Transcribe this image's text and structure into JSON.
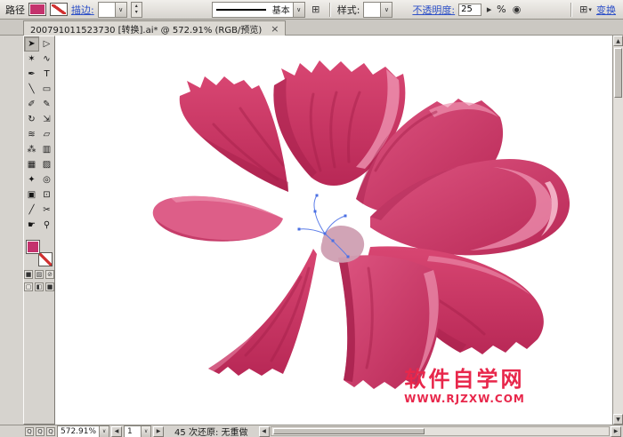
{
  "colors": {
    "chrome": "#d6d3ce",
    "link": "#2d50c8",
    "fill_swatch": "#c4326d",
    "petal_main": "#d84672",
    "petal_main2": "#dd5480",
    "petal_main_dark": "#b82856",
    "petal_light": "#ee93b1",
    "petal_lighter": "#f6bacd",
    "petal_dark": "#a31e4a",
    "petal_flat": "#dd5e88",
    "center_blob": "#cf9fb2",
    "edit_path": "#5b7ce8",
    "anchor": "#4a6fe3",
    "watermark": "#e8274b"
  },
  "control_bar": {
    "selection_type_label": "路径",
    "stroke_link": "描边:",
    "stroke_weight_value": "",
    "brush_value": "基本",
    "style_label": "样式:",
    "style_value": "",
    "opacity_link": "不透明度:",
    "opacity_value": "25",
    "percent_label": "%",
    "transform_link": "变换"
  },
  "document_tab": {
    "title": "200791011523730 [转换].ai* @ 572.91% (RGB/预览)",
    "close_glyph": "×"
  },
  "toolbar": {
    "tools": [
      {
        "name": "selection-tool",
        "glyph": "➤",
        "active": true
      },
      {
        "name": "direct-selection-tool",
        "glyph": "▷"
      },
      {
        "name": "magic-wand-tool",
        "glyph": "✶"
      },
      {
        "name": "lasso-tool",
        "glyph": "∿"
      },
      {
        "name": "pen-tool",
        "glyph": "✒"
      },
      {
        "name": "type-tool",
        "glyph": "T"
      },
      {
        "name": "line-segment-tool",
        "glyph": "╲"
      },
      {
        "name": "rectangle-tool",
        "glyph": "▭"
      },
      {
        "name": "paintbrush-tool",
        "glyph": "✐"
      },
      {
        "name": "pencil-tool",
        "glyph": "✎"
      },
      {
        "name": "rotate-tool",
        "glyph": "↻"
      },
      {
        "name": "scale-tool",
        "glyph": "⇲"
      },
      {
        "name": "warp-tool",
        "glyph": "≋"
      },
      {
        "name": "free-transform-tool",
        "glyph": "▱"
      },
      {
        "name": "symbol-sprayer-tool",
        "glyph": "⁂"
      },
      {
        "name": "column-graph-tool",
        "glyph": "▥"
      },
      {
        "name": "mesh-tool",
        "glyph": "▦"
      },
      {
        "name": "gradient-tool",
        "glyph": "▨"
      },
      {
        "name": "eyedropper-tool",
        "glyph": "✦"
      },
      {
        "name": "blend-tool",
        "glyph": "◎"
      },
      {
        "name": "live-paint-bucket-tool",
        "glyph": "▣"
      },
      {
        "name": "live-paint-selection-tool",
        "glyph": "⊡"
      },
      {
        "name": "slice-tool",
        "glyph": "╱"
      },
      {
        "name": "scissors-tool",
        "glyph": "✂"
      },
      {
        "name": "hand-tool",
        "glyph": "☛"
      },
      {
        "name": "zoom-tool",
        "glyph": "⚲"
      }
    ]
  },
  "status_bar": {
    "zoom_value": "572.91%",
    "page_value": "1",
    "history_status": "45 次还原: 无重做"
  },
  "watermark": {
    "site_name": "软件自学网",
    "site_url": "WWW.RJZXW.COM"
  },
  "icons": {
    "chevron_down": "∨",
    "tri_up": "▴",
    "tri_down": "▾",
    "stepper_right": "▸",
    "arrow_up": "▲",
    "arrow_down": "▼",
    "arrow_left": "◀",
    "arrow_right": "▶",
    "recolor": "◉",
    "grid_menu": "⊞",
    "color_swatch": "■",
    "gradient_swatch": "▨",
    "none_swatch": "⊘",
    "screen_normal": "▢",
    "screen_menu": "◧",
    "screen_full": "■",
    "zoom_glyph": "Q"
  }
}
